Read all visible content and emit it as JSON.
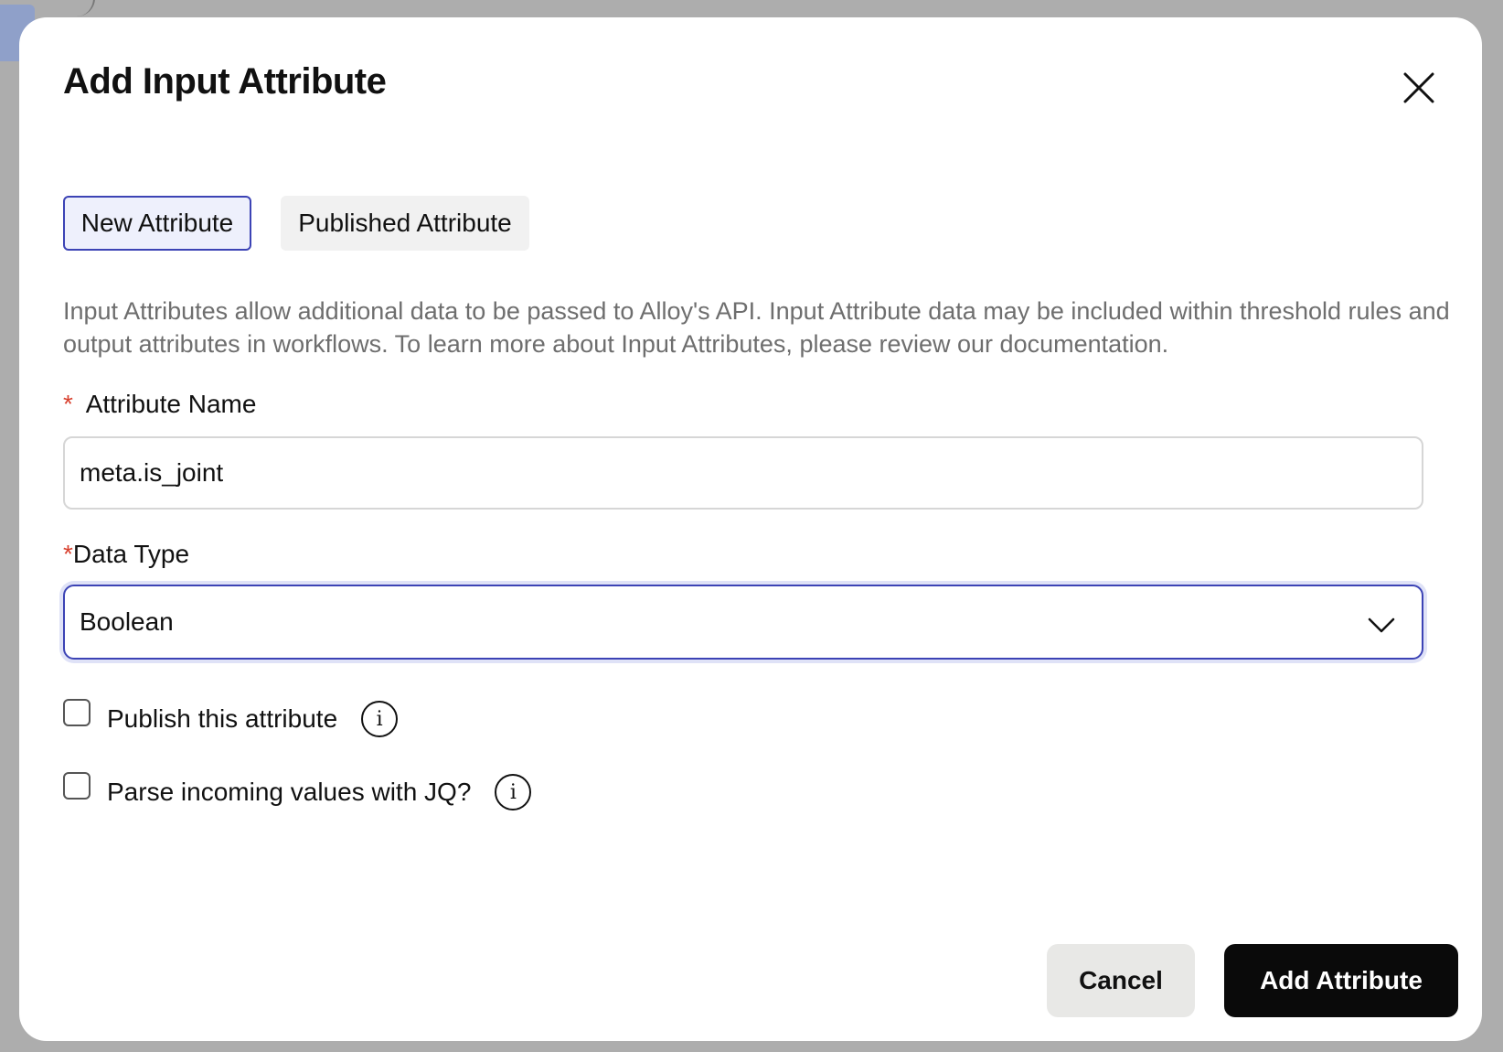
{
  "modal": {
    "title": "Add Input Attribute",
    "close_icon": "close-icon"
  },
  "tabs": [
    {
      "label": "New Attribute",
      "active": true
    },
    {
      "label": "Published Attribute",
      "active": false
    }
  ],
  "description": "Input Attributes allow additional data to be passed to Alloy's API. Input Attribute data may be included within threshold rules and output attributes in workflows. To learn more about Input Attributes, please review our documentation.",
  "fields": {
    "attribute_name": {
      "required_marker": "*",
      "label": "Attribute Name",
      "value": "meta.is_joint"
    },
    "data_type": {
      "required_marker": "*",
      "label": "Data Type",
      "value": "Boolean",
      "icon": "chevron-down-icon"
    }
  },
  "checkboxes": [
    {
      "label": "Publish this attribute",
      "checked": false,
      "icon": "info-icon"
    },
    {
      "label": "Parse incoming values with JQ?",
      "checked": false,
      "icon": "info-icon"
    }
  ],
  "buttons": {
    "cancel": "Cancel",
    "submit": "Add Attribute"
  },
  "colors": {
    "accent": "#3c43b5",
    "required": "#d8412f",
    "primary_button": "#0a0a0a",
    "overlay": "#adadad"
  }
}
